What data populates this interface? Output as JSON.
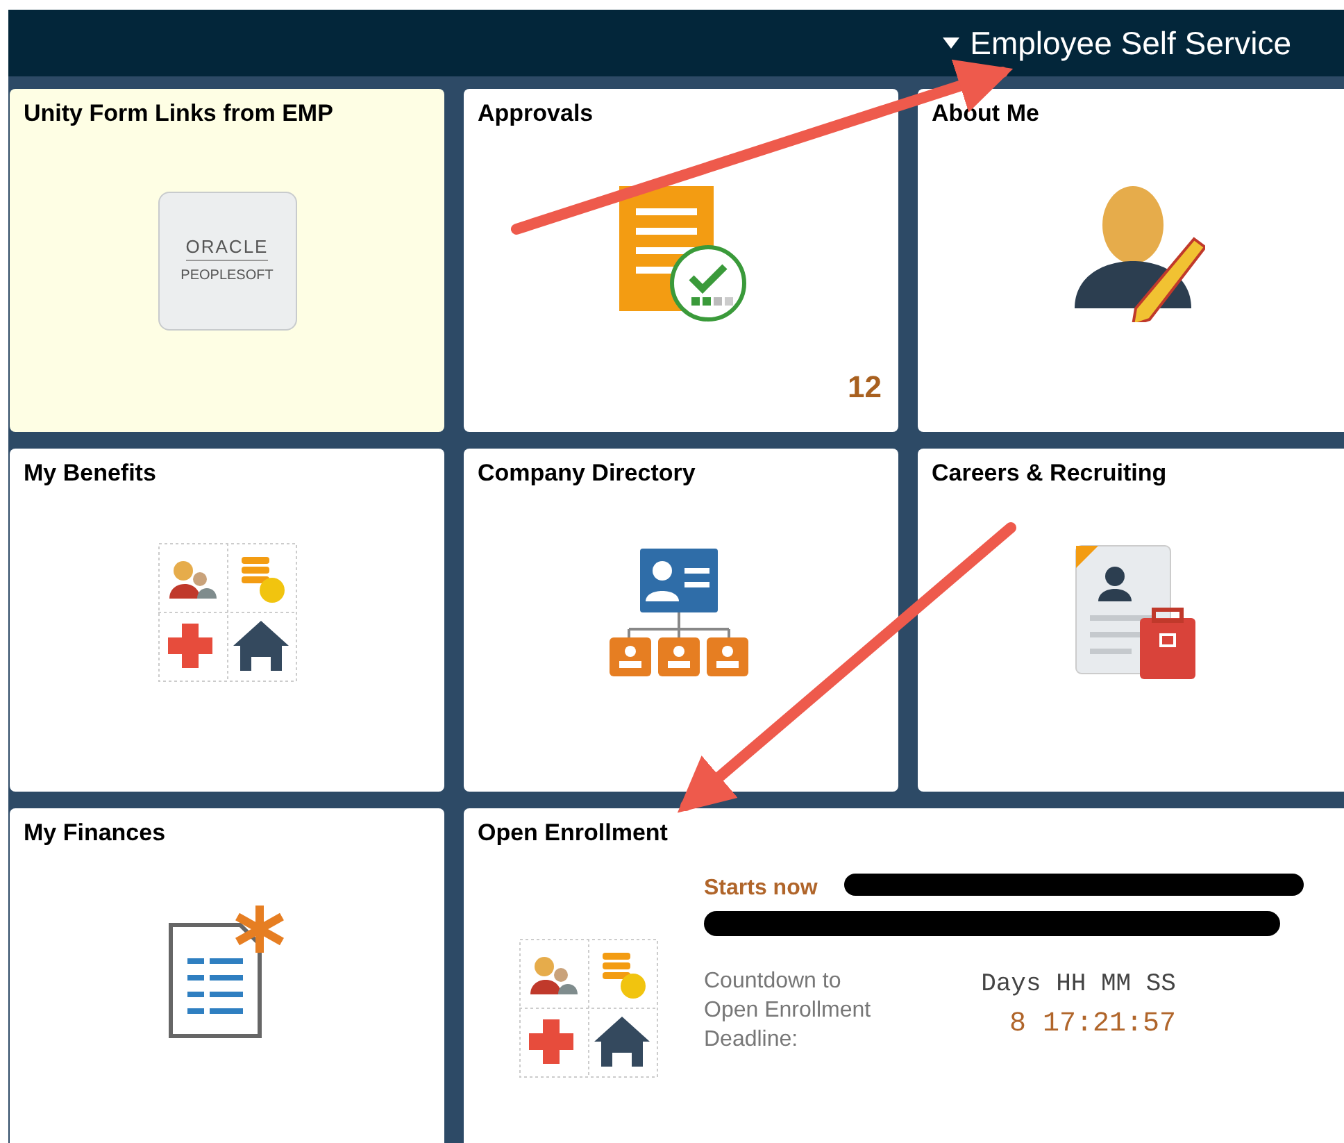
{
  "header": {
    "title": "Employee Self Service"
  },
  "tiles": [
    {
      "title": "Unity Form Links from EMP",
      "kind": "oracle",
      "highlighted": true,
      "logo_text": [
        "ORACLE",
        "PEOPLESOFT"
      ]
    },
    {
      "title": "Approvals",
      "kind": "approvals",
      "highlighted": false,
      "count": "12"
    },
    {
      "title": "About Me",
      "kind": "about",
      "highlighted": false
    },
    {
      "title": "My Benefits",
      "kind": "benefits",
      "highlighted": false
    },
    {
      "title": "Company Directory",
      "kind": "directory",
      "highlighted": false
    },
    {
      "title": "Careers & Recruiting",
      "kind": "careers",
      "highlighted": false
    },
    {
      "title": "My Finances",
      "kind": "finances",
      "highlighted": false
    },
    {
      "title": "Open Enrollment",
      "kind": "enrollment",
      "highlighted": false,
      "notice": "Starts now",
      "redacted": true,
      "countdown_label": "Countdown to Open Enrollment Deadline:",
      "units": "Days HH MM SS",
      "remaining": "8 17:21:57"
    }
  ],
  "annotations": [
    {
      "kind": "arrow"
    },
    {
      "kind": "arrow"
    }
  ]
}
